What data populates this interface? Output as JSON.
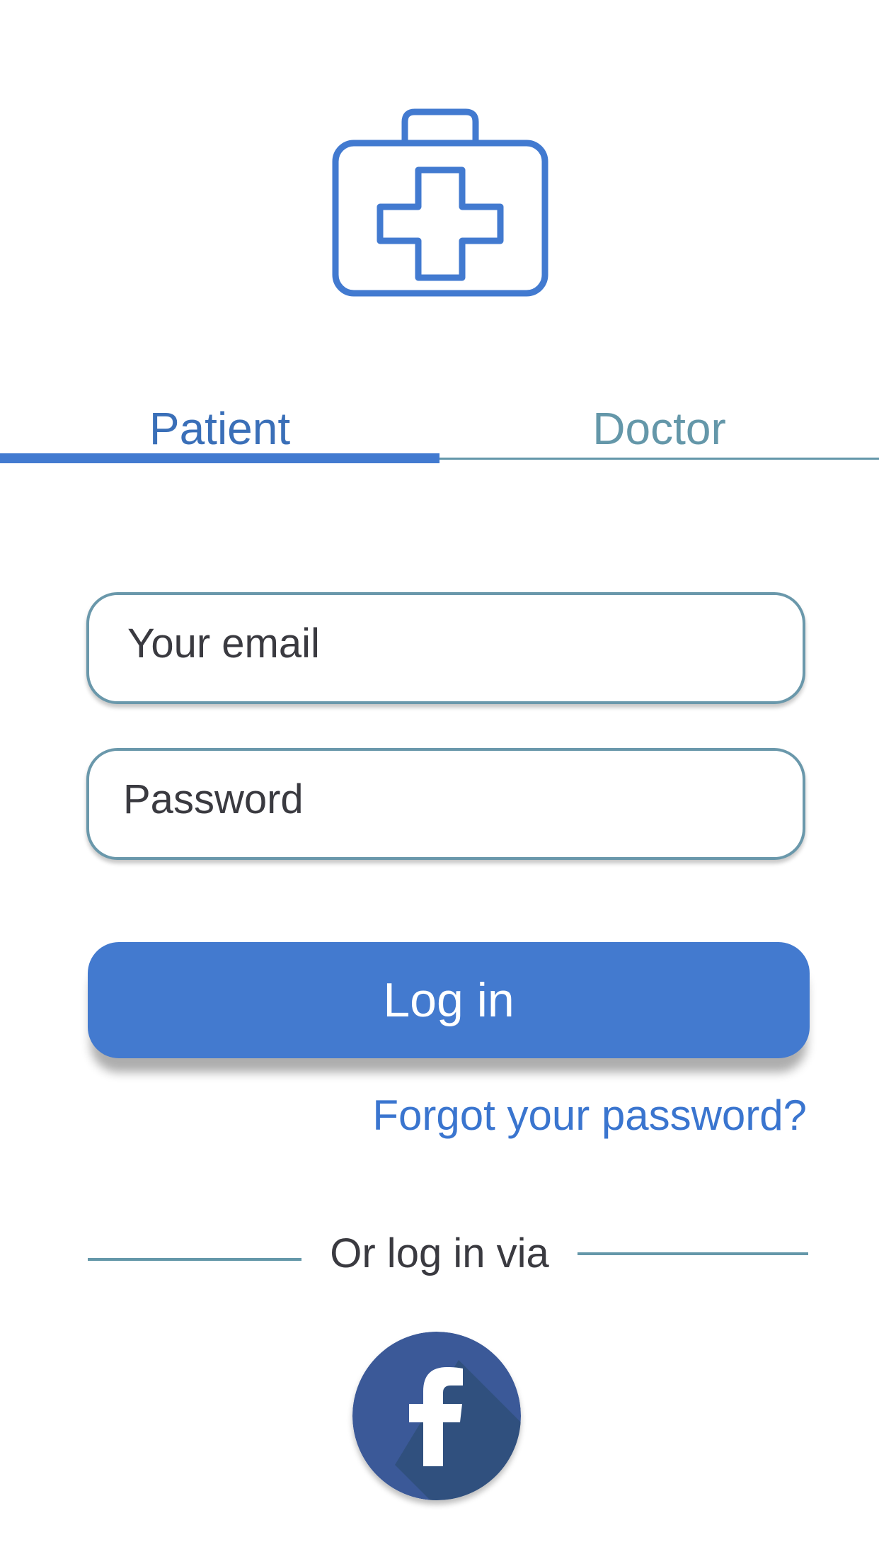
{
  "app": {
    "logo_icon": "medical-kit-icon",
    "accent_color": "#437acf"
  },
  "tabs": [
    {
      "label": "Patient",
      "selected": true
    },
    {
      "label": "Doctor",
      "selected": false
    }
  ],
  "form": {
    "email_placeholder": "Your email",
    "email_value": "",
    "password_placeholder": "Password",
    "password_value": "",
    "login_label": "Log in",
    "forgot_label": "Forgot your password?"
  },
  "social": {
    "divider_label": "Or log in via",
    "facebook_icon": "facebook-icon",
    "facebook_color": "#3b5998"
  }
}
